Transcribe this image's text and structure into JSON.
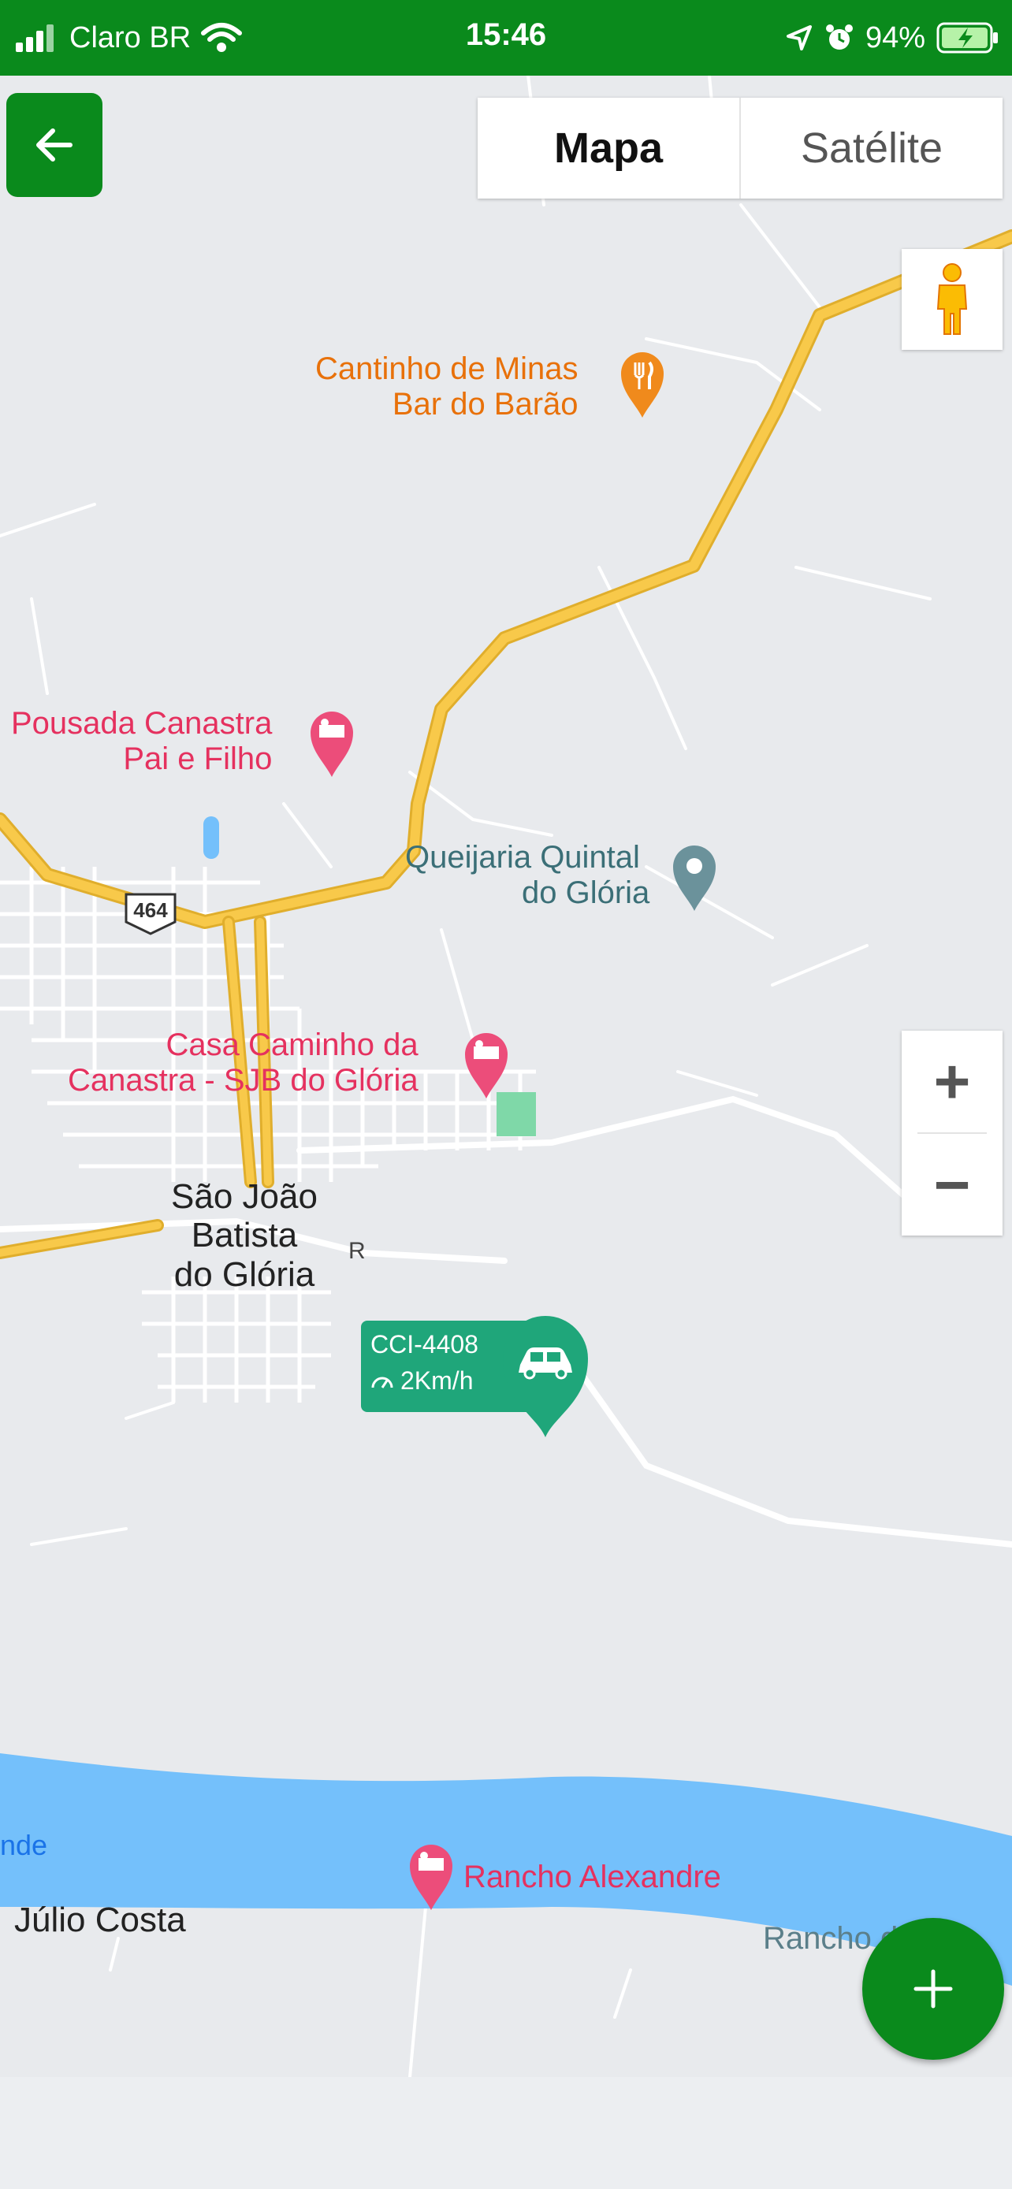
{
  "status_bar": {
    "carrier": "Claro BR",
    "time": "15:46",
    "battery": "94%"
  },
  "map_type": {
    "map_label": "Mapa",
    "satellite_label": "Satélite",
    "selected": "Mapa"
  },
  "zoom": {
    "in_label": "+",
    "out_label": "−"
  },
  "map_labels": {
    "poi_restaurant": [
      "Cantinho de Minas",
      "Bar do Barão"
    ],
    "poi_pousada": [
      "Pousada Canastra",
      "Pai e Filho"
    ],
    "poi_queijaria": [
      "Queijaria Quintal",
      "do Glória"
    ],
    "poi_casa": [
      "Casa Caminho da",
      "Canastra - SJB do Glória"
    ],
    "town": [
      "São João",
      "Batista",
      "do Glória"
    ],
    "road_shield": "464",
    "road_letter": "R",
    "river_fragment": "nde",
    "julio_costa": "Júlio Costa",
    "rancho_alexandre": "Rancho Alexandre",
    "rancho_partial": "Rancho d"
  },
  "vehicle": {
    "plate": "CCI-4408",
    "speed": "2Km/h"
  },
  "colors": {
    "primary": "#0a8a1c",
    "vehicle": "#1fa67a",
    "water": "#74c0fb",
    "highway": "#f8c94a",
    "map_bg": "#e8eaed"
  },
  "icons": [
    "back-arrow-icon",
    "pegman-icon",
    "restaurant-icon",
    "hotel-icon",
    "place-icon",
    "car-icon",
    "speedometer-icon",
    "plus-icon"
  ]
}
